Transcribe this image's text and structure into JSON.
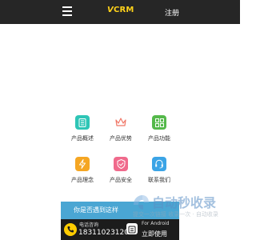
{
  "header": {
    "logo_prefix": "V",
    "logo_text": "VCRM",
    "register_label": "注册"
  },
  "features": [
    {
      "label": "产品概述",
      "icon": "document-list-icon",
      "color": "#2ec5b6"
    },
    {
      "label": "产品优势",
      "icon": "crown-icon",
      "color": "#f07868"
    },
    {
      "label": "产品功能",
      "icon": "grid-tiles-icon",
      "color": "#55b94b"
    },
    {
      "label": "产品理念",
      "icon": "lightning-icon",
      "color": "#f5a623"
    },
    {
      "label": "产品安全",
      "icon": "shield-check-icon",
      "color": "#f06a8c"
    },
    {
      "label": "联系我们",
      "icon": "headset-icon",
      "color": "#3ba4e6"
    }
  ],
  "banner": {
    "text": "你是否遇到这样"
  },
  "footer": {
    "call_label": "电话咨询",
    "call_number": "18311023120",
    "android_label": "For Android",
    "use_label": "立即使用"
  },
  "watermark": {
    "title": "自动秒收录",
    "subtitle": "提交一次链接 收录一次 · 自动收录"
  },
  "colors": {
    "topbar": "#262626",
    "logo": "#ffd21a",
    "banner": "#4aa6d3",
    "footer": "#1c1c1c"
  }
}
